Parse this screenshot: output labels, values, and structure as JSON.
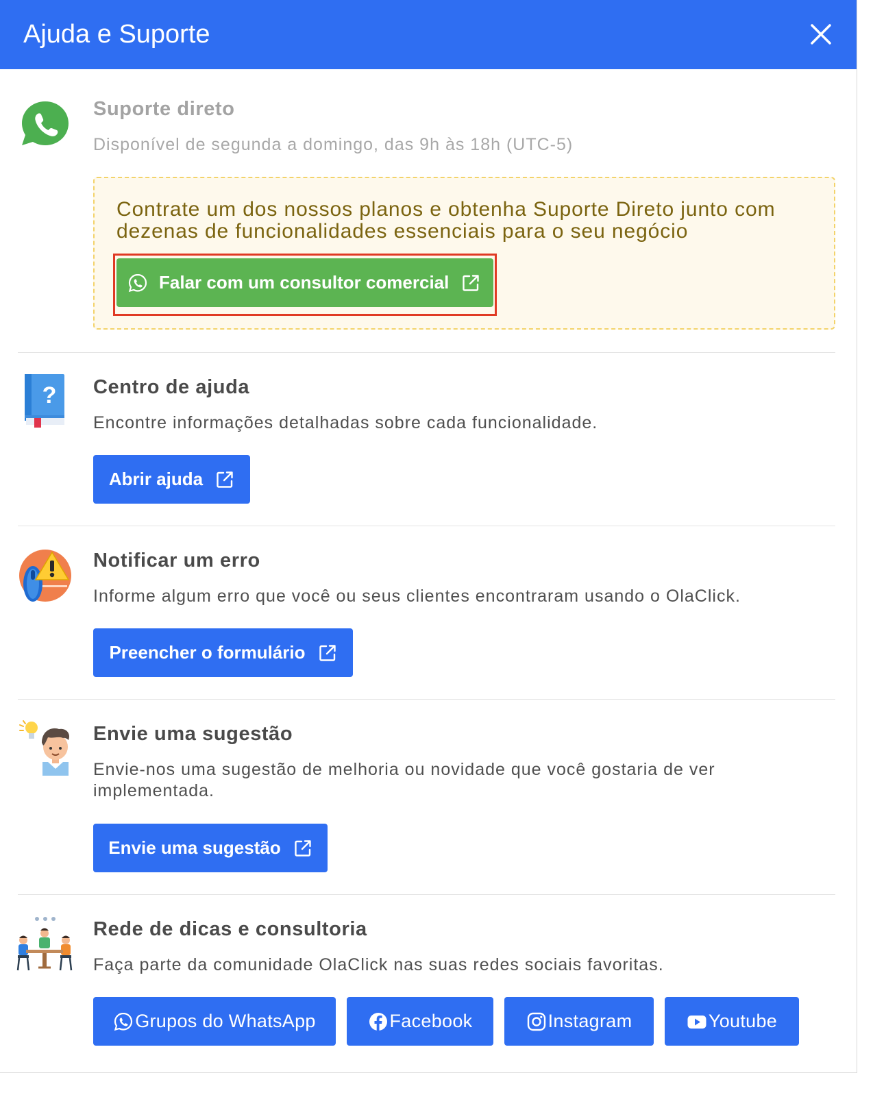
{
  "header": {
    "title": "Ajuda e Suporte"
  },
  "direct_support": {
    "title": "Suporte direto",
    "description": "Disponível de segunda a domingo, das 9h às 18h (UTC-5)",
    "promo_text": "Contrate um dos nossos planos e obtenha Suporte Direto junto com dezenas de funcionalidades essenciais para o seu negócio",
    "button_label": "Falar com um consultor comercial"
  },
  "help_center": {
    "title": "Centro de ajuda",
    "description": "Encontre informações detalhadas sobre cada funcionalidade.",
    "button_label": "Abrir ajuda"
  },
  "report_error": {
    "title": "Notificar um erro",
    "description": "Informe algum erro que você ou seus clientes encontraram usando o OlaClick.",
    "button_label": "Preencher o formulário"
  },
  "suggestion": {
    "title": "Envie uma sugestão",
    "description": "Envie-nos uma sugestão de melhoria ou novidade que você gostaria de ver implementada.",
    "button_label": "Envie uma sugestão"
  },
  "community": {
    "title": "Rede de dicas e consultoria",
    "description": "Faça parte da comunidade OlaClick nas suas redes sociais favoritas.",
    "buttons": [
      {
        "label": "Grupos do WhatsApp",
        "icon": "whatsapp-icon"
      },
      {
        "label": "Facebook",
        "icon": "facebook-icon"
      },
      {
        "label": "Instagram",
        "icon": "instagram-icon"
      },
      {
        "label": "Youtube",
        "icon": "youtube-icon"
      }
    ]
  },
  "colors": {
    "primary": "#2f6ef2",
    "whatsapp_green": "#5cb452",
    "promo_background": "#fef9ec",
    "promo_border": "#f3d36a",
    "promo_text": "#7b6410",
    "highlight_border": "#e03a24"
  }
}
